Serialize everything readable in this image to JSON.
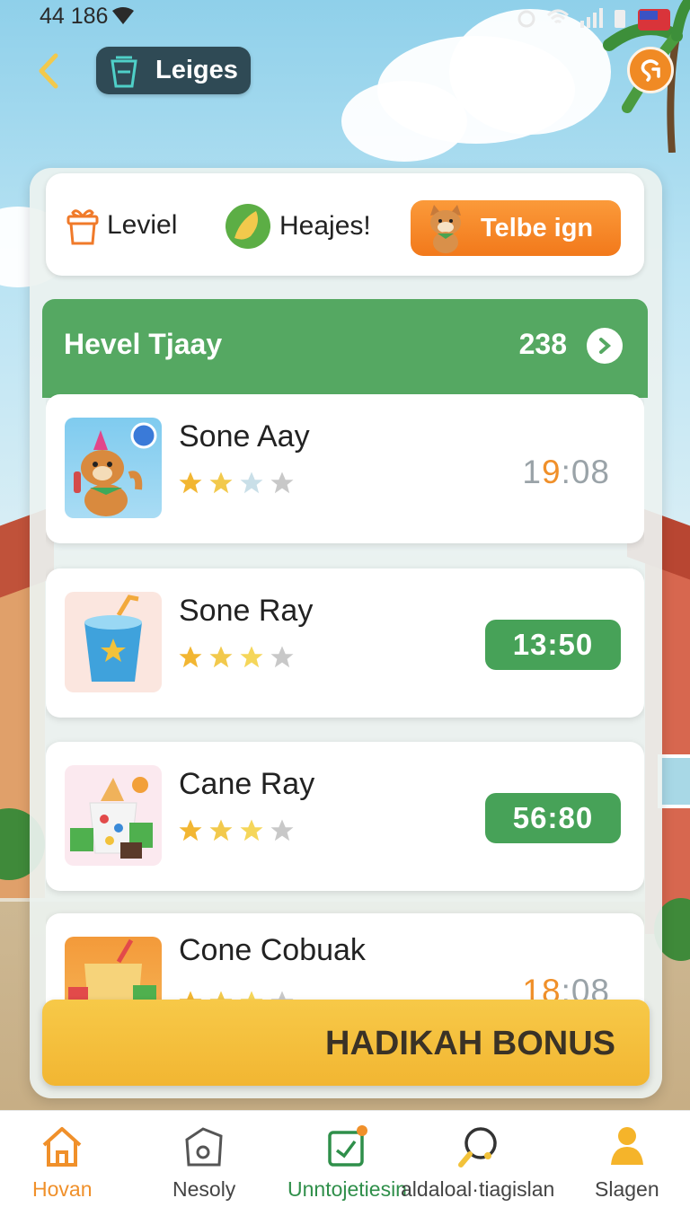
{
  "status": {
    "time": "44 186"
  },
  "header": {
    "title": "Leiges"
  },
  "topcard": {
    "item1_label": "Leviel",
    "item2_label": "Heajes!",
    "promo_label": "Telbe ign"
  },
  "section": {
    "title": "Hevel Tjaay",
    "count": "238"
  },
  "items": [
    {
      "name": "Sone Aay",
      "rating": 2,
      "max": 4,
      "time_a": "1",
      "time_b": "9",
      "time_c": ":08",
      "style": "plain"
    },
    {
      "name": "Sone Ray",
      "rating": 3,
      "max": 4,
      "time": "13:50",
      "style": "pill"
    },
    {
      "name": "Cane Ray",
      "rating": 3,
      "max": 4,
      "time": "56:80",
      "style": "pill"
    },
    {
      "name": "Cone Cobuak",
      "rating": 3,
      "max": 4,
      "time_a": "18",
      "time_b": ":08",
      "style": "plain-orange"
    }
  ],
  "bonus": {
    "label": "HADIKAH BONUS"
  },
  "nav": [
    {
      "label": "Hovan"
    },
    {
      "label": "Nesoly"
    },
    {
      "label": "Unntojetiesin"
    },
    {
      "label": "aldaloal·tiagislan"
    },
    {
      "label": "Slagen"
    }
  ],
  "colors": {
    "accent_orange": "#f0902a",
    "green": "#55a862",
    "bonus_yellow": "#f2b632",
    "header_pill": "#2f4a55"
  }
}
